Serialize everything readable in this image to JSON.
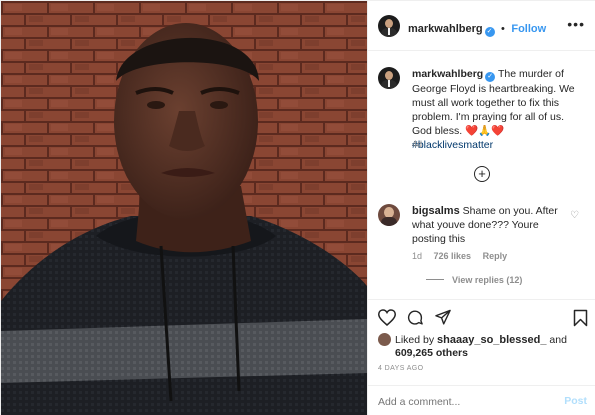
{
  "header": {
    "username": "markwahlberg",
    "verified_icon": "verified-badge-icon",
    "separator": "•",
    "follow_label": "Follow",
    "more_icon": "more-options-icon",
    "more_glyph": "•••"
  },
  "caption": {
    "username": "markwahlberg",
    "text": "The murder of George Floyd is heartbreaking. We must all work together to fix this problem. I'm praying for all of us. God bless.",
    "emojis": "❤️🙏❤️",
    "hashtag": "#blacklivesmatter",
    "age": "4d"
  },
  "load_more_glyph": "+",
  "comment": {
    "username": "bigsalms",
    "text": "Shame on you. After what youve done??? Youre posting this",
    "age": "1d",
    "likes": "726 likes",
    "reply_label": "Reply",
    "view_replies": "View replies (12)"
  },
  "actions": {
    "icons": [
      "heart-icon",
      "comment-icon",
      "share-icon",
      "bookmark-icon"
    ]
  },
  "likes": {
    "prefix": "Liked by",
    "user": "shaaay_so_blessed_",
    "and": "and",
    "count": "609,265 others"
  },
  "date": "4 DAYS AGO",
  "add_comment": {
    "placeholder": "Add a comment...",
    "post_label": "Post"
  },
  "colors": {
    "accent": "#3897f0",
    "hashtag": "#00376b",
    "muted": "#8e8e8e",
    "post_disabled": "#b2dffc"
  }
}
